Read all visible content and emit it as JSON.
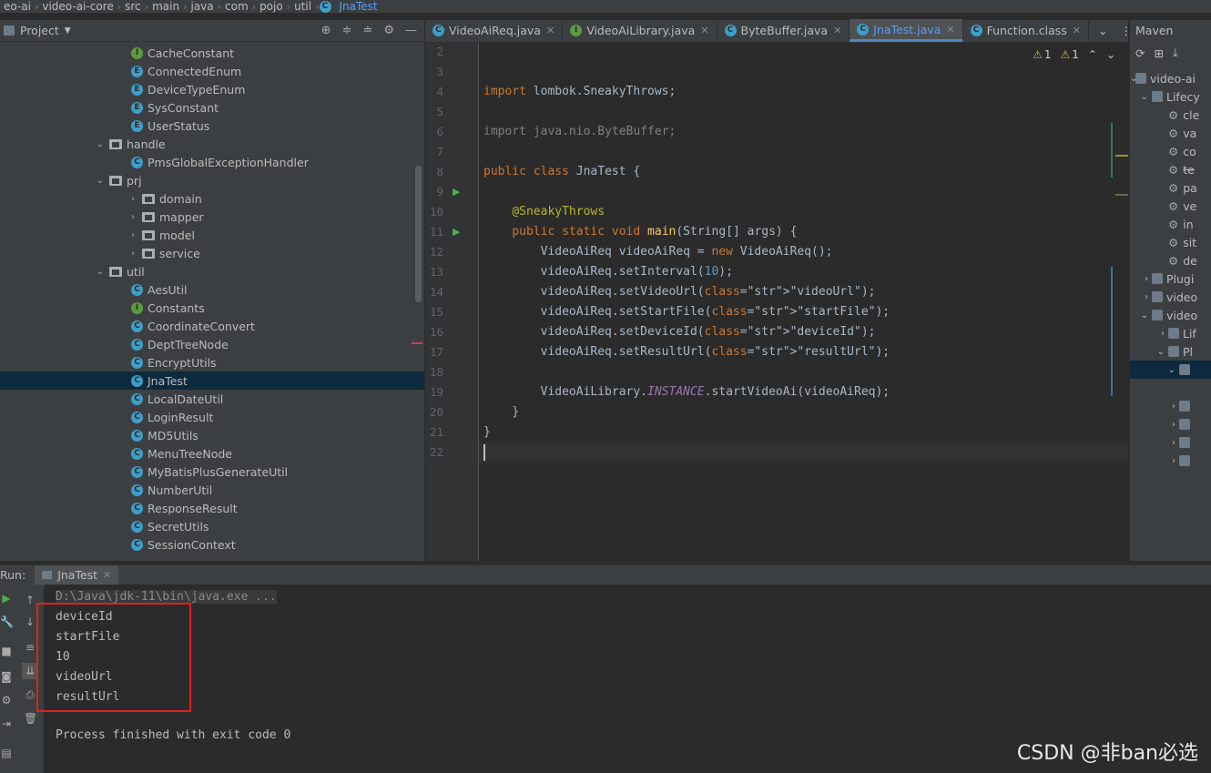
{
  "breadcrumb": [
    "eo-ai",
    "video-ai-core",
    "src",
    "main",
    "java",
    "com",
    "pojo",
    "util",
    "JnaTest"
  ],
  "project": {
    "title": "Project",
    "items": [
      {
        "label": "CacheConstant",
        "icon": "interface-icon",
        "depth": 2
      },
      {
        "label": "ConnectedEnum",
        "icon": "enum-icon",
        "depth": 2
      },
      {
        "label": "DeviceTypeEnum",
        "icon": "enum-icon",
        "depth": 2
      },
      {
        "label": "SysConstant",
        "icon": "enum-icon",
        "depth": 2
      },
      {
        "label": "UserStatus",
        "icon": "enum-icon",
        "depth": 2
      },
      {
        "label": "handle",
        "icon": "folder-icon",
        "depth": 1,
        "expanded": true
      },
      {
        "label": "PmsGlobalExceptionHandler",
        "icon": "class-icon",
        "depth": 2
      },
      {
        "label": "prj",
        "icon": "folder-icon",
        "depth": 1,
        "expanded": true
      },
      {
        "label": "domain",
        "icon": "folder-icon",
        "depth": 2,
        "expanded": false
      },
      {
        "label": "mapper",
        "icon": "folder-icon",
        "depth": 2,
        "expanded": false
      },
      {
        "label": "model",
        "icon": "folder-icon",
        "depth": 2,
        "expanded": false
      },
      {
        "label": "service",
        "icon": "folder-icon",
        "depth": 2,
        "expanded": false
      },
      {
        "label": "util",
        "icon": "folder-icon",
        "depth": 1,
        "expanded": true
      },
      {
        "label": "AesUtil",
        "icon": "class-icon",
        "depth": 2
      },
      {
        "label": "Constants",
        "icon": "interface-icon",
        "depth": 2
      },
      {
        "label": "CoordinateConvert",
        "icon": "class-icon",
        "depth": 2
      },
      {
        "label": "DeptTreeNode",
        "icon": "class-icon",
        "depth": 2
      },
      {
        "label": "EncryptUtils",
        "icon": "class-icon",
        "depth": 2
      },
      {
        "label": "JnaTest",
        "icon": "class-icon",
        "depth": 2,
        "selected": true
      },
      {
        "label": "LocalDateUtil",
        "icon": "class-icon",
        "depth": 2
      },
      {
        "label": "LoginResult",
        "icon": "class-icon",
        "depth": 2
      },
      {
        "label": "MD5Utils",
        "icon": "class-icon",
        "depth": 2
      },
      {
        "label": "MenuTreeNode",
        "icon": "class-icon",
        "depth": 2
      },
      {
        "label": "MyBatisPlusGenerateUtil",
        "icon": "class-icon",
        "depth": 2
      },
      {
        "label": "NumberUtil",
        "icon": "class-icon",
        "depth": 2
      },
      {
        "label": "ResponseResult",
        "icon": "class-icon",
        "depth": 2
      },
      {
        "label": "SecretUtils",
        "icon": "class-icon",
        "depth": 2
      },
      {
        "label": "SessionContext",
        "icon": "class-icon",
        "depth": 2
      }
    ]
  },
  "tabs": [
    {
      "label": "VideoAiReq.java",
      "icon": "class-icon"
    },
    {
      "label": "VideoAiLibrary.java",
      "icon": "interface-icon"
    },
    {
      "label": "ByteBuffer.java",
      "icon": "class-icon"
    },
    {
      "label": "JnaTest.java",
      "icon": "class-icon",
      "active": true
    },
    {
      "label": "Function.class",
      "icon": "class-icon"
    }
  ],
  "inspections": {
    "warnings": "1",
    "weak_warnings": "1"
  },
  "editor": {
    "line_numbers": [
      "2",
      "3",
      "4",
      "5",
      "6",
      "7",
      "8",
      "9",
      "10",
      "11",
      "12",
      "13",
      "14",
      "15",
      "16",
      "17",
      "18",
      "19",
      "20",
      "21",
      "22"
    ],
    "lines": [
      "",
      "",
      "import lombok.SneakyThrows;",
      "",
      "import java.nio.ByteBuffer;",
      "",
      "public class JnaTest {",
      "",
      "    @SneakyThrows",
      "    public static void main(String[] args) {",
      "        VideoAiReq videoAiReq = new VideoAiReq();",
      "        videoAiReq.setInterval(10);",
      "        videoAiReq.setVideoUrl(\"videoUrl\");",
      "        videoAiReq.setStartFile(\"startFile\");",
      "        videoAiReq.setDeviceId(\"deviceId\");",
      "        videoAiReq.setResultUrl(\"resultUrl\");",
      "",
      "        VideoAiLibrary.INSTANCE.startVideoAi(videoAiReq);",
      "    }",
      "}",
      ""
    ]
  },
  "maven": {
    "title": "Maven",
    "items": [
      "video-ai",
      "Lifecy",
      "cle",
      "va",
      "co",
      "te",
      "pa",
      "ve",
      "in",
      "sit",
      "de",
      "Plugi",
      "video",
      "video",
      "Lif",
      "Pl"
    ]
  },
  "run": {
    "label": "Run:",
    "tab": "JnaTest",
    "command": "D:\\Java\\jdk-11\\bin\\java.exe ...",
    "output": [
      "deviceId",
      "startFile",
      "10",
      "videoUrl",
      "resultUrl"
    ],
    "exit": "Process finished with exit code 0"
  },
  "watermark": "CSDN @非ban必选"
}
